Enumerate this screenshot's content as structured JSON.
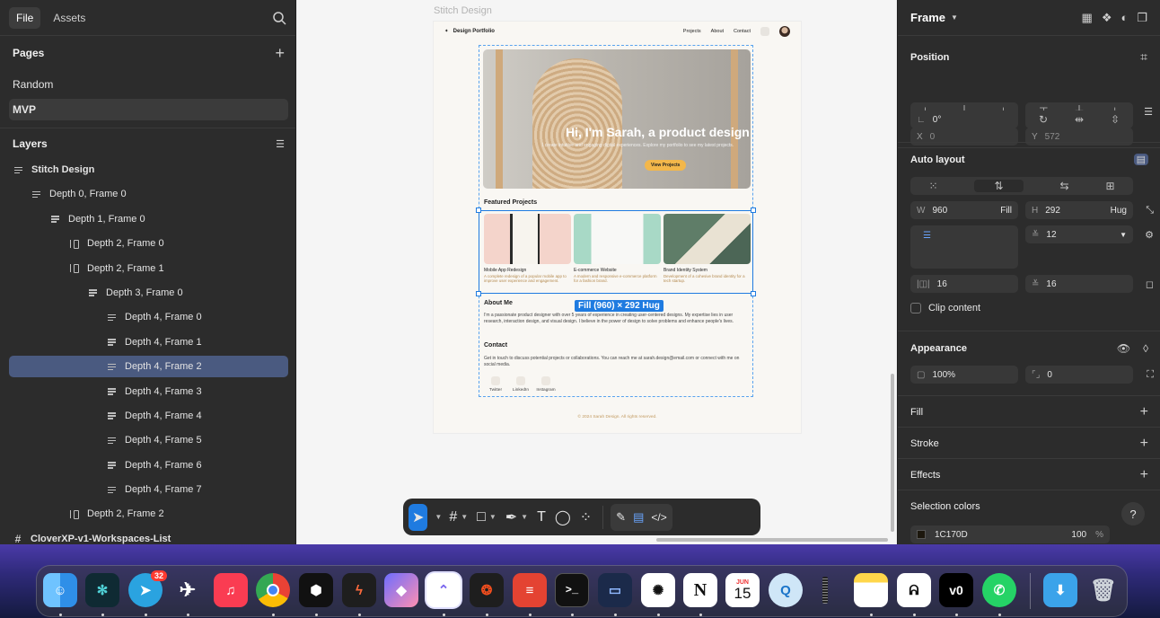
{
  "left_panel": {
    "tabs": [
      "File",
      "Assets"
    ],
    "pages_title": "Pages",
    "pages": [
      "Random",
      "MVP"
    ],
    "layers_title": "Layers",
    "layers": [
      "Stitch Design",
      "Depth 0, Frame 0",
      "Depth 1, Frame 0",
      "Depth 2, Frame 0",
      "Depth 2, Frame 1",
      "Depth 3, Frame 0",
      "Depth 4, Frame 0",
      "Depth 4, Frame 1",
      "Depth 4, Frame 2",
      "Depth 4, Frame 3",
      "Depth 4, Frame 4",
      "Depth 4, Frame 5",
      "Depth 4, Frame 6",
      "Depth 4, Frame 7",
      "Depth 2, Frame 2",
      "CloverXP-v1-Workspaces-List"
    ]
  },
  "canvas": {
    "frame_label": "Stitch Design",
    "site": {
      "brand": "Design Portfolio",
      "nav": [
        "Projects",
        "About",
        "Contact"
      ],
      "hero_title": "Hi, I'm Sarah, a product design",
      "hero_sub": "I create intuitive and engaging digital experiences. Explore my portfolio to see my latest projects.",
      "hero_button": "View Projects",
      "featured_heading": "Featured Projects",
      "projects": [
        {
          "title": "Mobile App Redesign",
          "desc": "A complete redesign of a popular mobile app to improve user experience and engagement."
        },
        {
          "title": "E-commerce Website",
          "desc": "A modern and responsive e-commerce platform for a fashion brand."
        },
        {
          "title": "Brand Identity System",
          "desc": "Development of a cohesive brand identity for a tech startup."
        }
      ],
      "about_heading": "About Me",
      "about_text": "I'm a passionate product designer with over 5 years of experience in creating user-centered designs. My expertise lies in user research, interaction design, and visual design. I believe in the power of design to solve problems and enhance people's lives.",
      "contact_heading": "Contact",
      "contact_text": "Get in touch to discuss potential projects or collaborations. You can reach me at sarah.design@email.com or connect with me on social media.",
      "socials": [
        "Twitter",
        "LinkedIn",
        "Instagram"
      ],
      "footer": "© 2024 Sarah Design. All rights reserved."
    },
    "selection_badge": "Fill (960) × 292 Hug"
  },
  "right_panel": {
    "title": "Frame",
    "position_title": "Position",
    "x_label": "X",
    "x_value": "0",
    "y_label": "Y",
    "y_value": "572",
    "rotation": "0°",
    "auto_layout_title": "Auto layout",
    "w_label": "W",
    "w_value": "960",
    "w_mode": "Fill",
    "h_label": "H",
    "h_value": "292",
    "h_mode": "Hug",
    "gap": "12",
    "padding_h": "16",
    "padding_v": "16",
    "clip_content": "Clip content",
    "appearance_title": "Appearance",
    "opacity": "100%",
    "radius": "0",
    "fill_title": "Fill",
    "stroke_title": "Stroke",
    "effects_title": "Effects",
    "selection_colors_title": "Selection colors",
    "selection_color_hex": "1C170D",
    "selection_color_opacity": "100",
    "percent": "%",
    "help": "?"
  },
  "dock": {
    "telegram_badge": "32",
    "calendar_month": "JUN",
    "calendar_day": "15",
    "apps": [
      "Finder",
      "Perplexity",
      "Telegram",
      "Paperplane",
      "Music",
      "Chrome",
      "Cube",
      "Spark",
      "Shapes",
      "ClickUp",
      "Figma",
      "Todoist",
      "Terminal",
      "Remote",
      "ChatGPT",
      "Notion",
      "Calendar",
      "QuickTime",
      "Battery",
      "Notes",
      "Alpaca",
      "v0",
      "WhatsApp",
      "Downloads",
      "Trash"
    ]
  },
  "colors": {
    "accent": "#1f7be0",
    "panel": "#2c2c2c",
    "selected_layer": "#4a5a80",
    "hero_button": "#f3b74a"
  }
}
